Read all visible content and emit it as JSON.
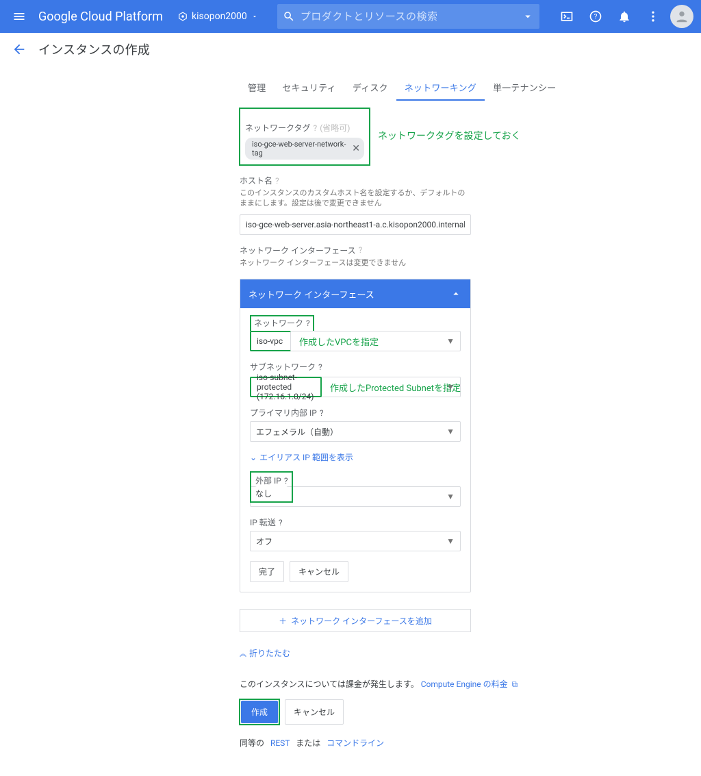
{
  "topbar": {
    "brand": "Google Cloud Platform",
    "project_name": "kisopon2000",
    "search_placeholder": "プロダクトとリソースの検索"
  },
  "subbar": {
    "title": "インスタンスの作成"
  },
  "tabs": {
    "management": "管理",
    "security": "セキュリティ",
    "disks": "ディスク",
    "networking": "ネットワーキング",
    "sole_tenancy": "単一テナンシー"
  },
  "network_tags": {
    "label": "ネットワークタグ",
    "optional": "(省略可)",
    "chip": "iso-gce-web-server-network-tag",
    "annotation": "ネットワークタグを設定しておく"
  },
  "hostname": {
    "label": "ホスト名",
    "desc": "このインスタンスのカスタムホスト名を設定するか、デフォルトのままにします。設定は後で変更できません",
    "value": "iso-gce-web-server.asia-northeast1-a.c.kisopon2000.internal"
  },
  "nif_section": {
    "label": "ネットワーク インターフェース",
    "desc": "ネットワーク インターフェースは変更できません",
    "panel_title": "ネットワーク インターフェース"
  },
  "panel": {
    "network": {
      "label": "ネットワーク",
      "value": "iso-vpc",
      "annotation": "作成したVPCを指定"
    },
    "subnet": {
      "label": "サブネットワーク",
      "value": "iso-subnet-protected (172.16.1.0/24)",
      "annotation": "作成したProtected Subnetを指定"
    },
    "primary_ip": {
      "label": "プライマリ内部 IP",
      "value": "エフェメラル（自動）"
    },
    "alias_link": "エイリアス IP 範囲を表示",
    "external_ip": {
      "label": "外部 IP",
      "value": "なし"
    },
    "ip_forward": {
      "label": "IP 転送",
      "value": "オフ"
    },
    "done": "完了",
    "cancel": "キャンセル"
  },
  "add_iface": "ネットワーク インターフェースを追加",
  "collapse": "折りたたむ",
  "billing": {
    "text": "このインスタンスについては課金が発生します。",
    "link": "Compute Engine の料金"
  },
  "actions": {
    "create": "作成",
    "cancel": "キャンセル"
  },
  "footer": {
    "prefix": "同等の",
    "rest": "REST",
    "mid": "または",
    "cli": "コマンドライン"
  }
}
